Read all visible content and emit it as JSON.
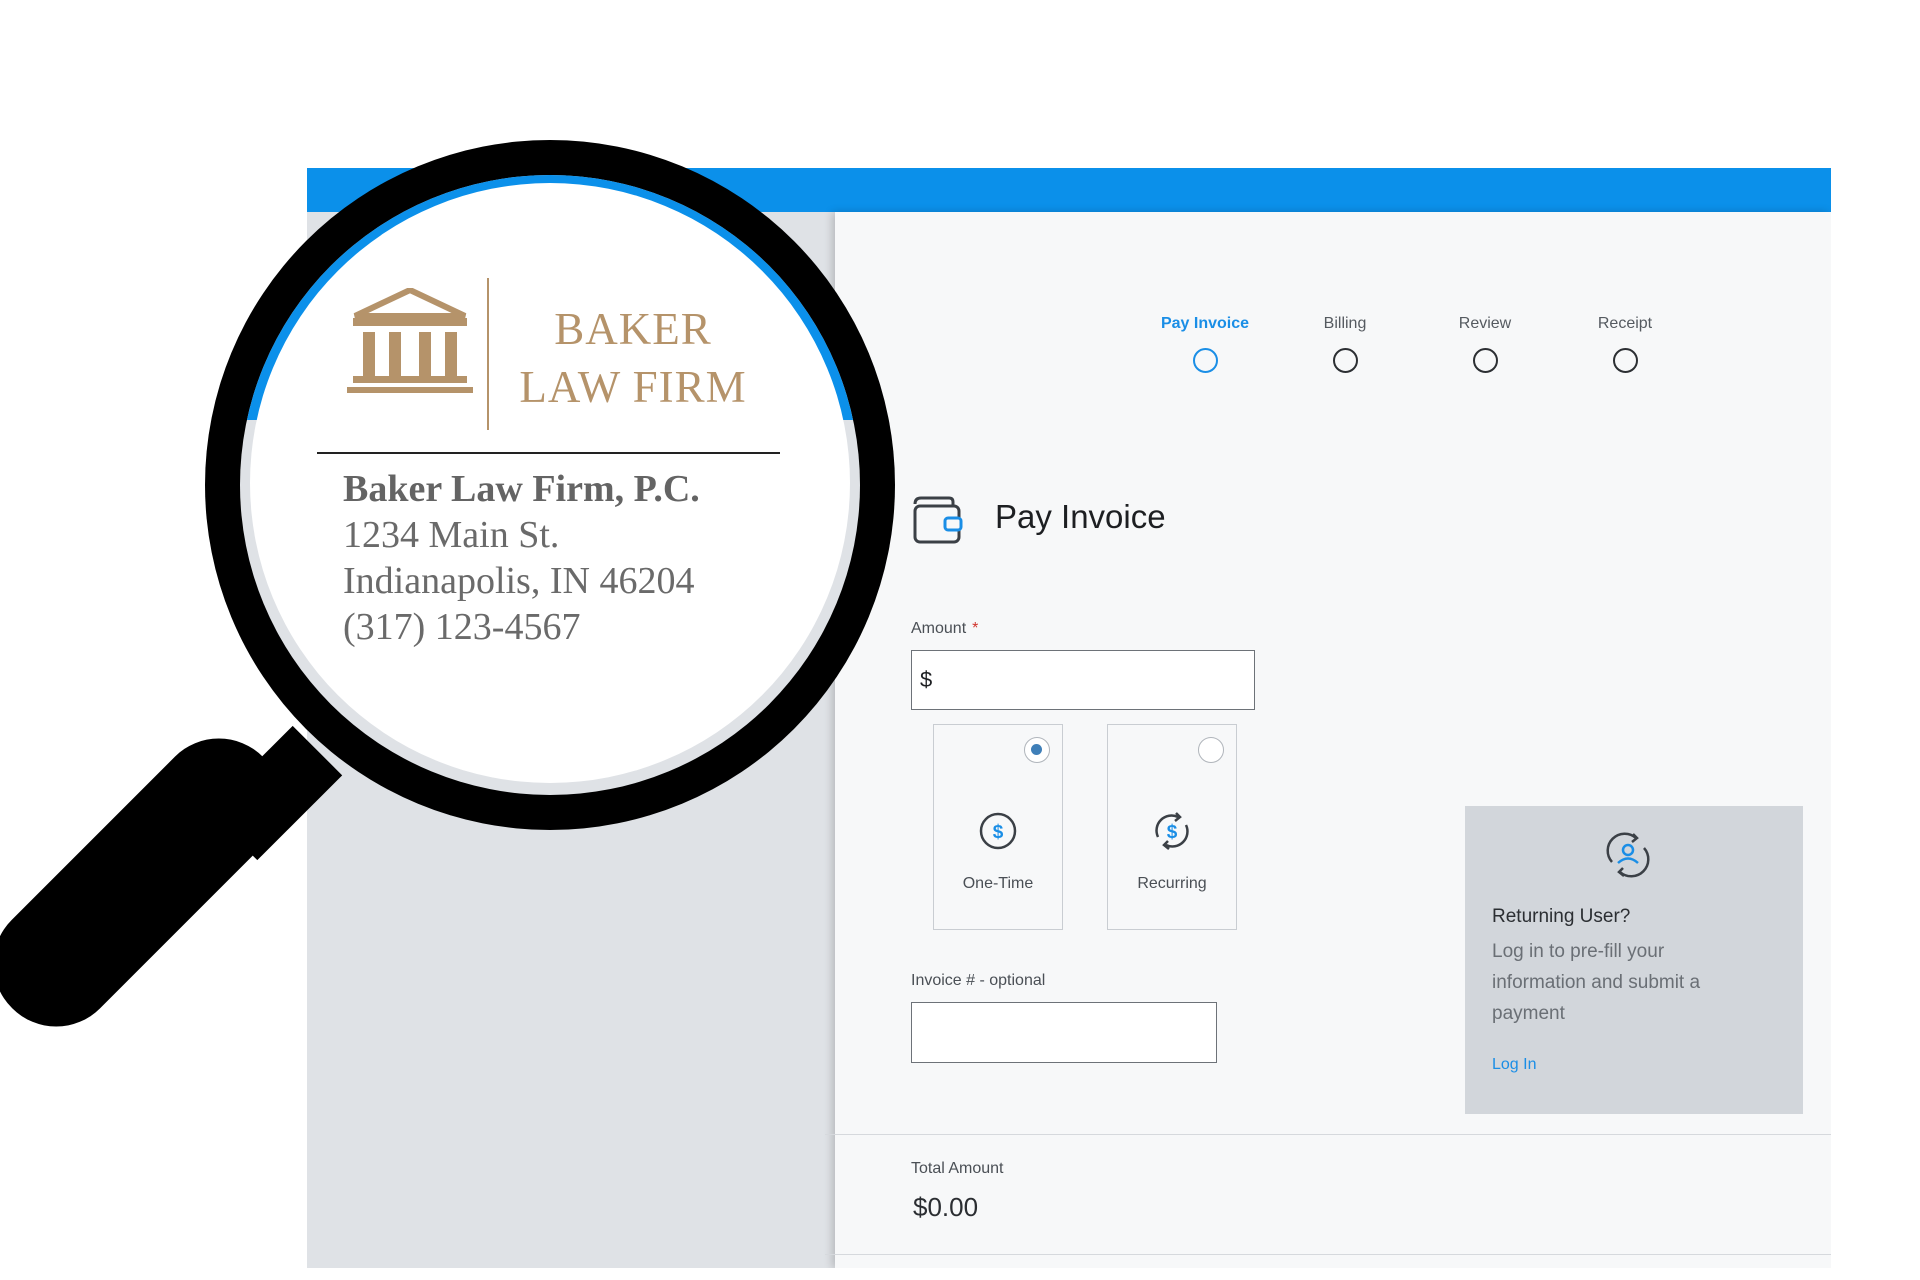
{
  "steps": [
    {
      "label": "Pay Invoice"
    },
    {
      "label": "Billing"
    },
    {
      "label": "Review"
    },
    {
      "label": "Receipt"
    }
  ],
  "page": {
    "title": "Pay Invoice"
  },
  "amount": {
    "label": "Amount",
    "required_mark": "*",
    "prefix": "$",
    "value": ""
  },
  "payment_types": [
    {
      "label": "One-Time",
      "selected": true,
      "icon": "dollar-circle-icon"
    },
    {
      "label": "Recurring",
      "selected": false,
      "icon": "recurring-dollar-icon"
    }
  ],
  "returning_user": {
    "title": "Returning User?",
    "description": "Log in to pre-fill your information and submit a payment",
    "link": "Log In",
    "icon": "returning-user-icon"
  },
  "invoice": {
    "label": "Invoice # - optional",
    "value": ""
  },
  "total": {
    "label": "Total Amount",
    "value": "$0.00"
  },
  "firm": {
    "logo_line1": "BAKER",
    "logo_line2": "LAW FIRM",
    "name": "Baker Law Firm, P.C.",
    "street": "1234 Main St.",
    "city": "Indianapolis, IN 46204",
    "phone": "(317) 123-4567",
    "icon": "courthouse-icon"
  },
  "colors": {
    "accent": "#1a8ee6",
    "header_blue": "#0b90ea",
    "logo_gold": "#b5936a"
  }
}
